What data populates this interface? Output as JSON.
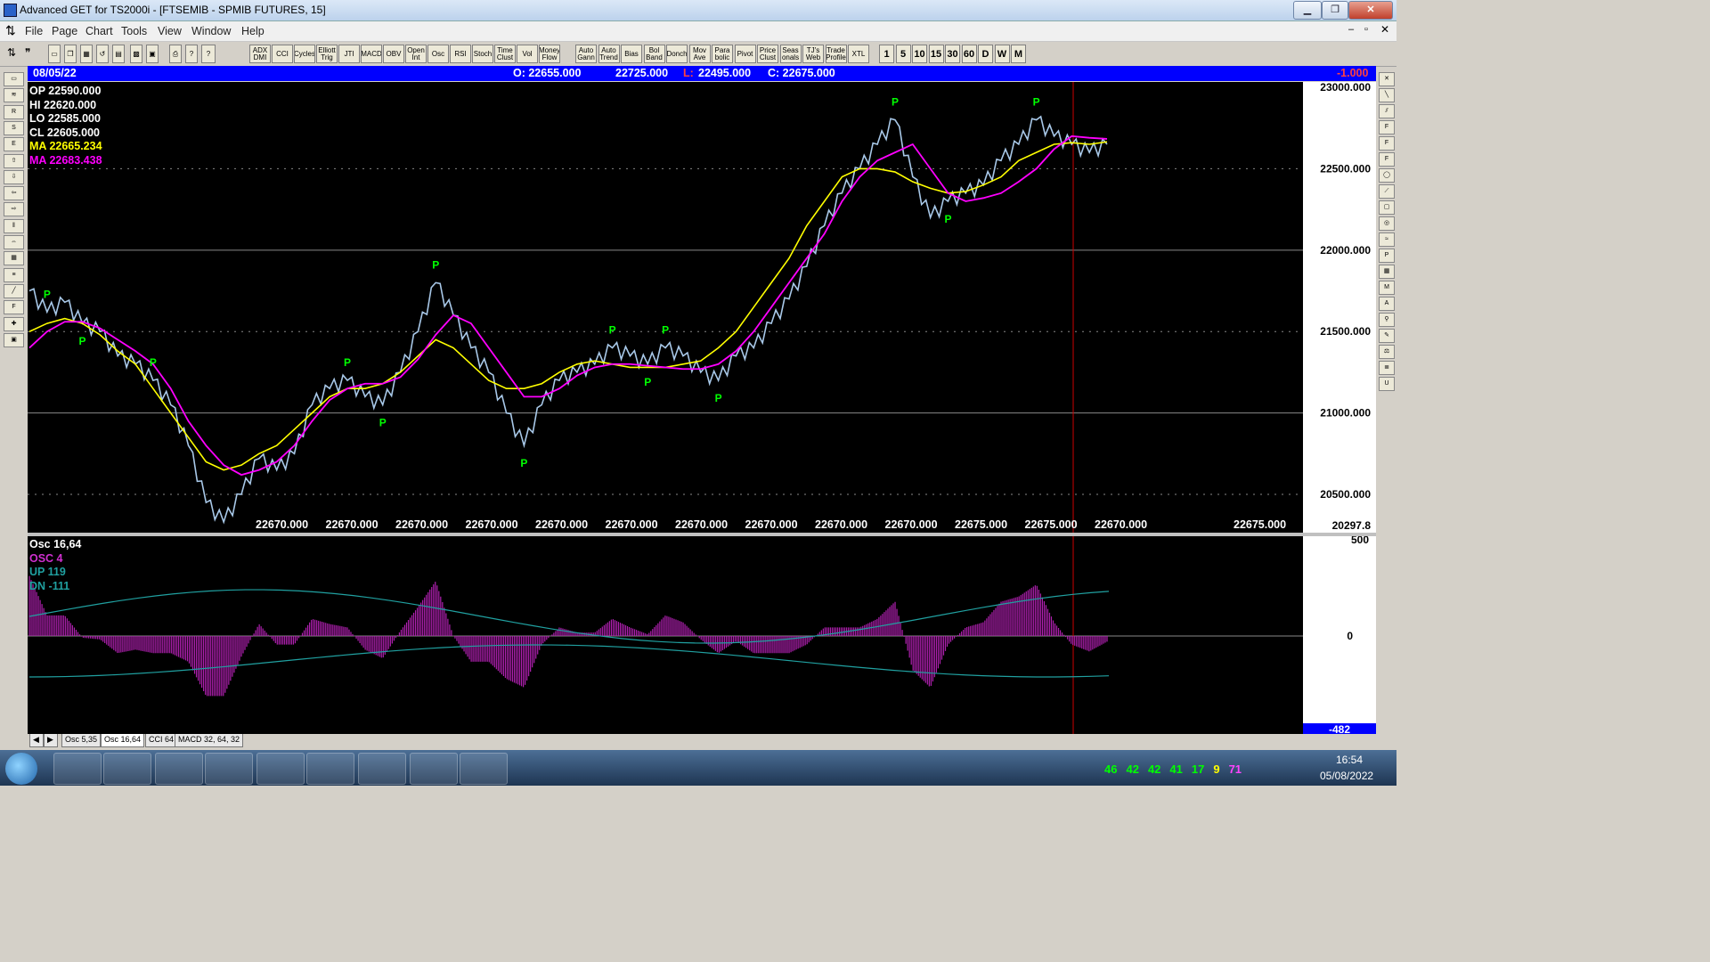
{
  "window": {
    "title": "Advanced GET for TS2000i - [FTSEMIB - SPMIB FUTURES, 15]"
  },
  "menu": [
    "File",
    "Page",
    "Chart",
    "Tools",
    "View",
    "Window",
    "Help"
  ],
  "toolbar": {
    "indicators": [
      "ADX DMI",
      "CCI",
      "Cycles",
      "Elliott Trig",
      "JTI",
      "MACD",
      "OBV",
      "Open Int",
      "Osc",
      "RSI",
      "Stoch",
      "Time Clust",
      "Vol",
      "Money Flow"
    ],
    "tools": [
      "Auto Gann",
      "Auto Trend",
      "Bias",
      "Bol Band",
      "Donch",
      "Mov Ave",
      "Para bolic",
      "Pivot",
      "Price Clust",
      "Seas onals",
      "TJ's Web",
      "Trade Profile",
      "XTL"
    ],
    "intervals": [
      "1",
      "5",
      "10",
      "15",
      "30",
      "60",
      "D",
      "W",
      "M"
    ]
  },
  "infobar": {
    "date": "08/05/22",
    "open": "O: 22655.000",
    "high": "22725.000",
    "low_label": "L:",
    "low": "22495.000",
    "close": "C: 22675.000",
    "change": "-1.000"
  },
  "legend": {
    "op": "OP  22590.000",
    "hi": "HI   22620.000",
    "lo": "LO  22585.000",
    "cl": "CL  22605.000",
    "ma1": "MA  22665.234",
    "ma2": "MA  22683.438"
  },
  "price_axis": [
    "23000.000",
    "22500.000",
    "22000.000",
    "21500.000",
    "21000.000",
    "20500.000",
    "20297.8"
  ],
  "bottom_labels": [
    "22670.000",
    "22670.000",
    "22670.000",
    "22670.000",
    "22670.000",
    "22670.000",
    "22670.000",
    "22670.000",
    "22670.000",
    "22670.000",
    "22675.000",
    "22675.000",
    "22670.000"
  ],
  "last_price": "22675.000",
  "pivot_label": "P",
  "osc": {
    "title": "Osc 16,64",
    "osc_line": "OSC 4",
    "up_line": "UP   119",
    "dn_line": "DN   -111",
    "axis_top": "500",
    "axis_zero": "0",
    "axis_bottom": "-482"
  },
  "tabs": [
    "Osc 5,35",
    "Osc 16,64",
    "CCI 64",
    "MACD 32, 64, 32"
  ],
  "tray": {
    "time": "16:54",
    "date": "05/08/2022",
    "numbers": [
      "46",
      "42",
      "42",
      "41",
      "17",
      "9",
      "71"
    ]
  },
  "colors": {
    "price": "#a8c8e8",
    "ma_fast": "#ffff00",
    "ma_slow": "#ff00ff",
    "osc": "#b020b0",
    "band": "#20a0a0",
    "pivot": "#00ff00",
    "cursor": "#cc0000"
  },
  "chart_data": {
    "type": "line",
    "ylim": [
      20297.8,
      23000
    ],
    "series": [
      {
        "values": [
          21750,
          21620,
          21680,
          21550,
          21500,
          21350,
          21300,
          21200,
          21050,
          20800,
          20450,
          20330,
          20500,
          20720,
          20650,
          20750,
          21050,
          21150,
          21200,
          21100,
          21050,
          21250,
          21500,
          21800,
          21600,
          21400,
          21250,
          21000,
          20800,
          21050,
          21200,
          21250,
          21300,
          21400,
          21350,
          21300,
          21400,
          21350,
          21250,
          21200,
          21350,
          21400,
          21550,
          21700,
          21900,
          22150,
          22350,
          22500,
          22650,
          22800,
          22450,
          22200,
          22300,
          22350,
          22400,
          22550,
          22650,
          22800,
          22700,
          22650,
          22600,
          22650
        ]
      },
      {
        "values": [
          21500,
          21550,
          21580,
          21550,
          21480,
          21380,
          21300,
          21150,
          21000,
          20850,
          20700,
          20650,
          20680,
          20750,
          20800,
          20900,
          21000,
          21100,
          21150,
          21150,
          21180,
          21250,
          21350,
          21450,
          21400,
          21300,
          21200,
          21150,
          21150,
          21180,
          21250,
          21300,
          21320,
          21300,
          21280,
          21280,
          21280,
          21300,
          21320,
          21400,
          21500,
          21650,
          21800,
          21950,
          22150,
          22300,
          22450,
          22500,
          22500,
          22480,
          22420,
          22380,
          22350,
          22360,
          22400,
          22450,
          22550,
          22600,
          22650,
          22660,
          22650,
          22665
        ]
      },
      {
        "values": [
          21400,
          21500,
          21560,
          21560,
          21520,
          21450,
          21380,
          21300,
          21150,
          20950,
          20800,
          20680,
          20620,
          20650,
          20700,
          20800,
          20950,
          21080,
          21150,
          21180,
          21180,
          21220,
          21330,
          21480,
          21600,
          21550,
          21400,
          21250,
          21100,
          21100,
          21150,
          21230,
          21280,
          21300,
          21300,
          21290,
          21280,
          21270,
          21270,
          21300,
          21380,
          21500,
          21650,
          21800,
          21950,
          22100,
          22300,
          22450,
          22550,
          22600,
          22650,
          22500,
          22350,
          22300,
          22320,
          22350,
          22420,
          22500,
          22620,
          22700,
          22690,
          22683
        ]
      }
    ]
  }
}
